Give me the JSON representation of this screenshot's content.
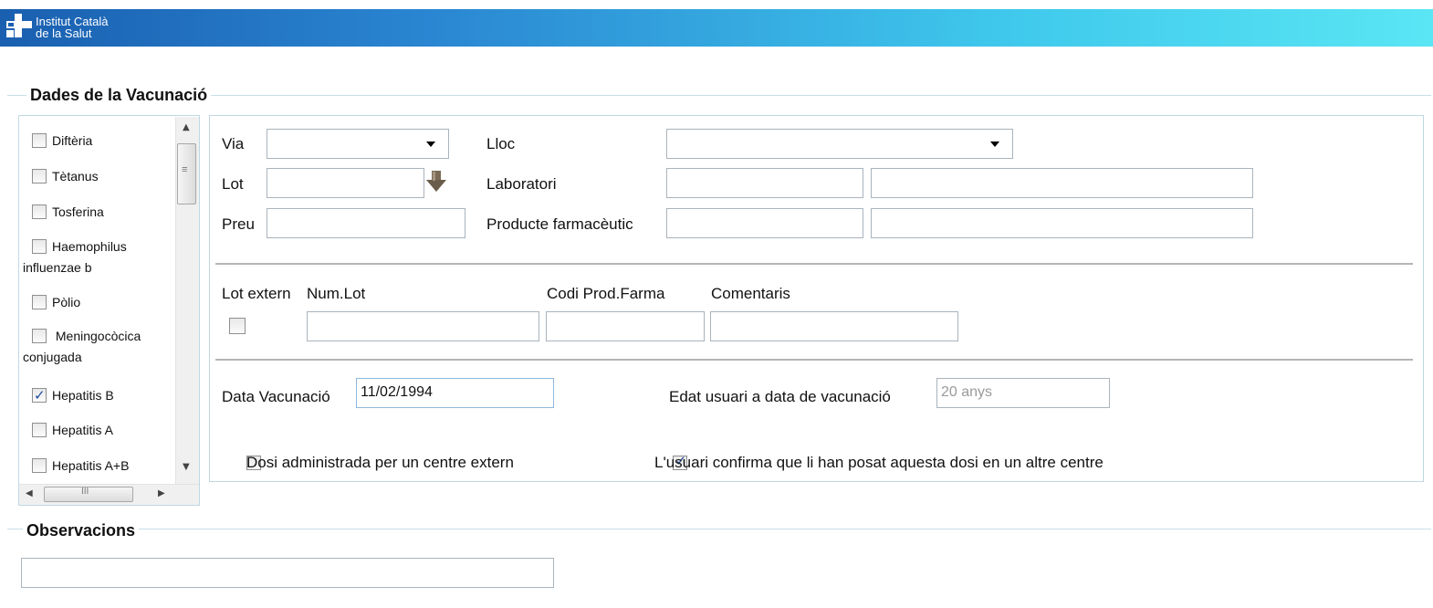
{
  "header": {
    "org_line1": "Institut Català",
    "org_line2": "de la Salut"
  },
  "sections": {
    "vaccination_title": "Dades de la Vacunació",
    "observations_title": "Observacions"
  },
  "vaccines": [
    {
      "lines": [
        "Diftèria"
      ],
      "checked": false
    },
    {
      "lines": [
        "Tètanus"
      ],
      "checked": false
    },
    {
      "lines": [
        "Tosferina"
      ],
      "checked": false
    },
    {
      "lines": [
        "Haemophilus",
        "influenzae b"
      ],
      "checked": false
    },
    {
      "lines": [
        "Pòlio"
      ],
      "checked": false
    },
    {
      "lines": [
        " Meningocòcica",
        "conjugada"
      ],
      "checked": false
    },
    {
      "lines": [
        "Hepatitis B"
      ],
      "checked": true
    },
    {
      "lines": [
        "Hepatitis A"
      ],
      "checked": false
    },
    {
      "lines": [
        "Hepatitis A+B"
      ],
      "checked": false
    }
  ],
  "form": {
    "via_label": "Via",
    "via_value": "",
    "lloc_label": "Lloc",
    "lloc_value": "",
    "lot_label": "Lot",
    "lot_value": "",
    "laboratori_label": "Laboratori",
    "laboratori_code": "",
    "laboratori_name": "",
    "preu_label": "Preu",
    "preu_value": "",
    "producte_label": "Producte farmacèutic",
    "producte_code": "",
    "producte_name": "",
    "lot_extern_label": "Lot extern",
    "lot_extern_checked": false,
    "num_lot_label": "Num.Lot",
    "num_lot_value": "",
    "codi_prod_label": "Codi Prod.Farma",
    "codi_prod_value": "",
    "comentaris_label": "Comentaris",
    "comentaris_value": "",
    "data_vacunacio_label": "Data Vacunació",
    "data_vacunacio_value": "11/02/1994",
    "edat_label": "Edat usuari a data de vacunació",
    "edat_value": "20 anys",
    "dosi_centre_extern_label": "Dosi administrada per un centre extern",
    "dosi_centre_extern_checked": false,
    "usuari_confirma_label": "L'usuari confirma que li han posat aquesta dosi en un altre centre",
    "usuari_confirma_checked": true
  },
  "observations": {
    "value": ""
  },
  "icons": {
    "logo": "catsalut-cross-logo",
    "lot_lookup": "arrow-down-icon"
  },
  "colors": {
    "header_start": "#1a5fb0",
    "header_end": "#5ae6f4",
    "panel_border": "#bfd8e2"
  }
}
